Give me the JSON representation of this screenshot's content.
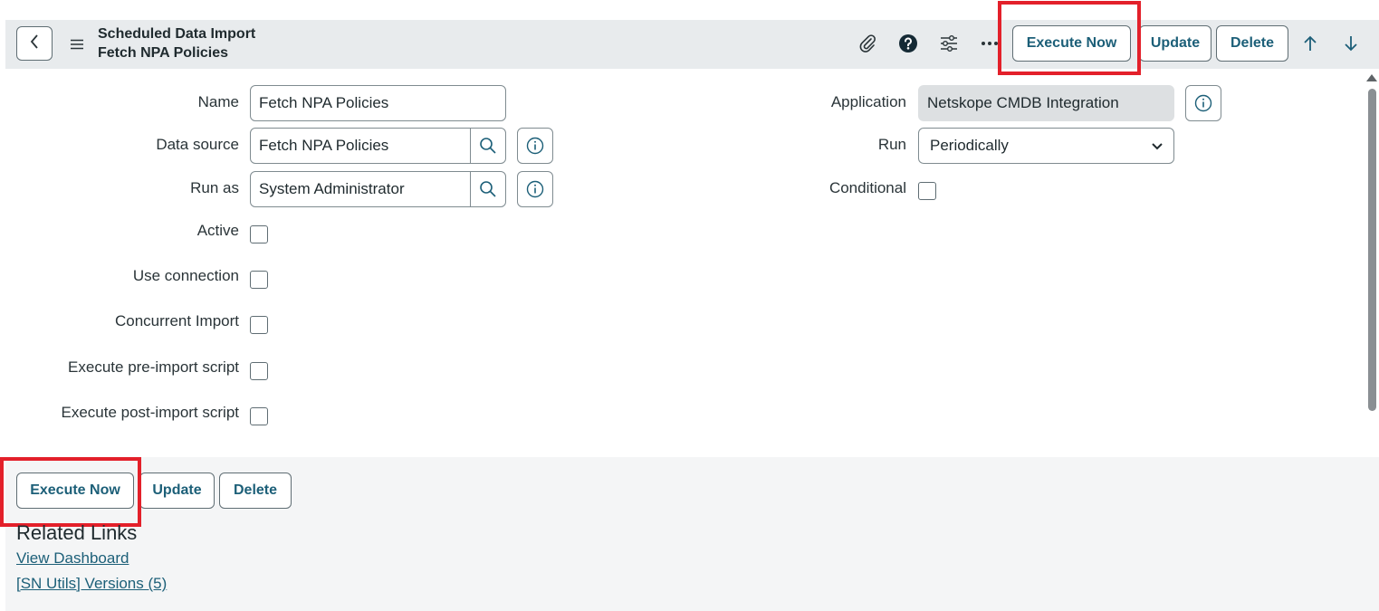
{
  "header": {
    "title": "Scheduled Data Import",
    "subtitle": "Fetch NPA Policies",
    "buttons": {
      "execute_now": "Execute Now",
      "update": "Update",
      "delete": "Delete"
    }
  },
  "form": {
    "name": {
      "label": "Name",
      "value": "Fetch NPA Policies"
    },
    "data_source": {
      "label": "Data source",
      "value": "Fetch NPA Policies"
    },
    "run_as": {
      "label": "Run as",
      "value": "System Administrator"
    },
    "active": {
      "label": "Active"
    },
    "use_connection": {
      "label": "Use connection"
    },
    "concurrent_import": {
      "label": "Concurrent Import"
    },
    "pre_import": {
      "label": "Execute pre-import script"
    },
    "post_import": {
      "label": "Execute post-import script"
    },
    "application": {
      "label": "Application",
      "value": "Netskope CMDB Integration"
    },
    "run": {
      "label": "Run",
      "value": "Periodically"
    },
    "conditional": {
      "label": "Conditional"
    }
  },
  "footer": {
    "buttons": {
      "execute_now": "Execute Now",
      "update": "Update",
      "delete": "Delete"
    },
    "related_links_title": "Related Links",
    "links": [
      "View Dashboard",
      "[SN Utils] Versions (5)"
    ]
  },
  "colors": {
    "accent": "#1c5f78",
    "highlight": "#e3202a",
    "header_bg": "#e8ebed"
  }
}
